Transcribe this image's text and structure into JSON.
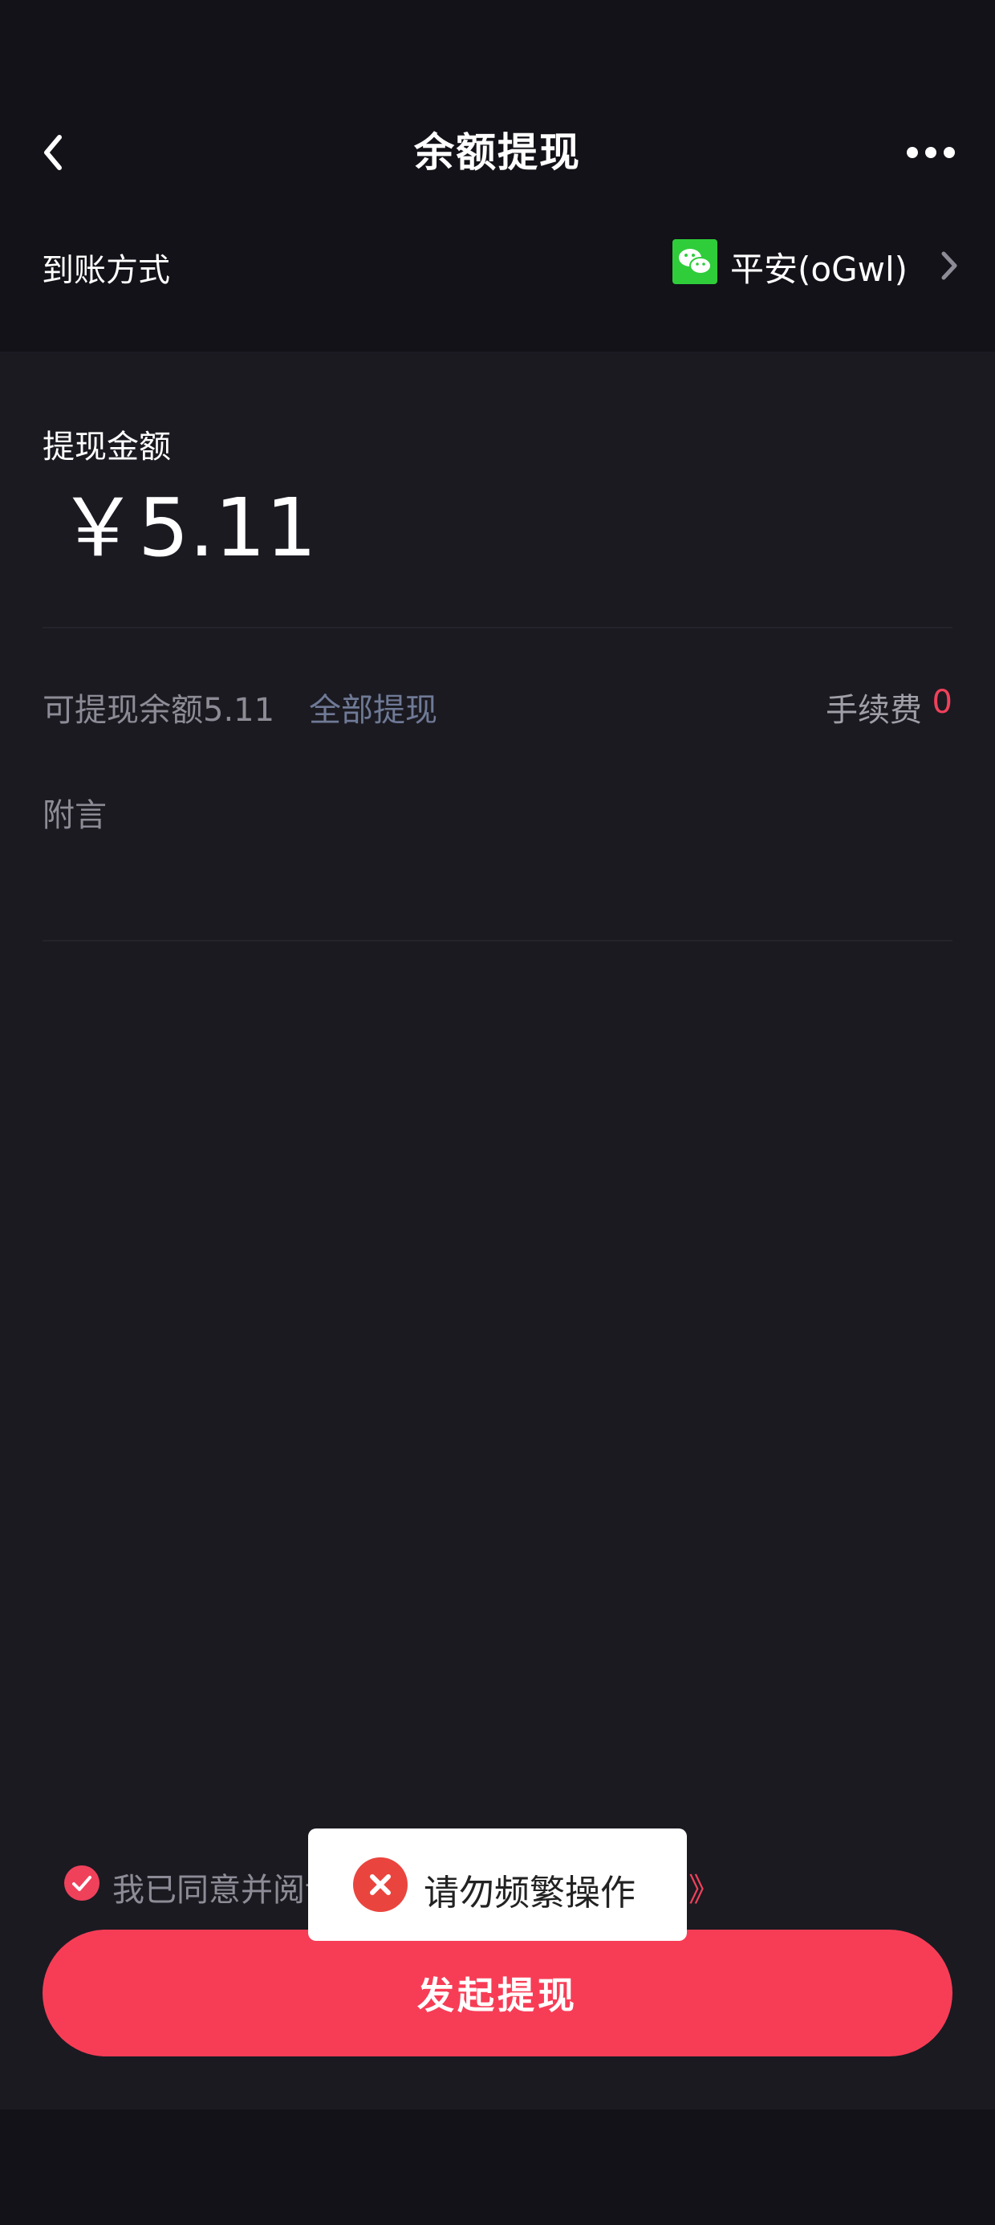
{
  "header": {
    "title": "余额提现",
    "back_icon": "chevron-left-icon",
    "more_icon": "more-horizontal-icon"
  },
  "payout_method": {
    "label": "到账方式",
    "value": "平安(oGwl)",
    "icon": "wechat-pay-icon",
    "icon_color": "#2fcd3a"
  },
  "amount": {
    "label": "提现金额",
    "value": "￥5.11"
  },
  "balance": {
    "text": "可提现余额5.11",
    "withdraw_all": "全部提现",
    "fee_label": "手续费",
    "fee_value": "0"
  },
  "remark": {
    "label": "附言"
  },
  "agreement": {
    "checked": true,
    "text_visible": "我已同意并阅读",
    "text_end": "》"
  },
  "submit": {
    "label": "发起提现"
  },
  "toast": {
    "text": "请勿频繁操作",
    "icon": "error-icon"
  },
  "colors": {
    "accent": "#f73d56",
    "link": "#6f7a96",
    "background": "#1b1a21"
  }
}
